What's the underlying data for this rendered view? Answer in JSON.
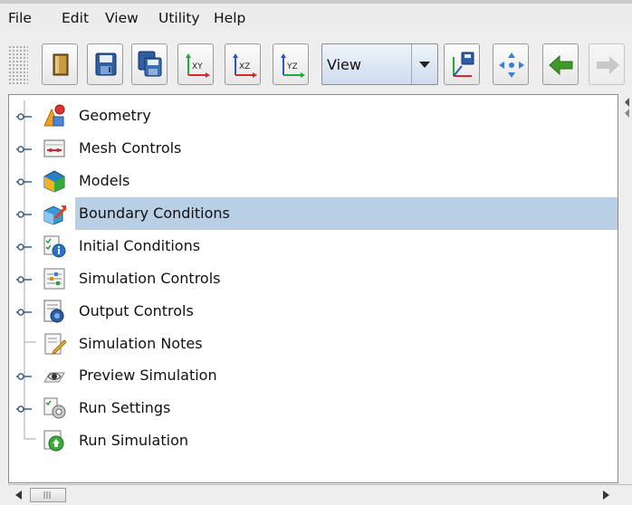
{
  "menubar": {
    "file": "File",
    "edit": "Edit",
    "view": "View",
    "utility": "Utility",
    "help": "Help"
  },
  "toolbar": {
    "buttons": [
      "open-icon",
      "save-icon",
      "save-all-icon",
      "axis-xy-icon",
      "axis-xz-icon",
      "axis-yz-icon",
      "export-view-icon",
      "pan-icon",
      "back-arrow-icon",
      "forward-arrow-icon"
    ],
    "axis_labels": {
      "xy": "XY",
      "xz": "XZ",
      "yz": "YZ"
    },
    "view_select": {
      "value": "View"
    }
  },
  "tree": {
    "selected_index": 3,
    "items": [
      {
        "label": "Geometry",
        "icon": "geometry-icon",
        "expandable": true
      },
      {
        "label": "Mesh Controls",
        "icon": "mesh-controls-icon",
        "expandable": true
      },
      {
        "label": "Models",
        "icon": "models-icon",
        "expandable": true
      },
      {
        "label": "Boundary Conditions",
        "icon": "boundary-conditions-icon",
        "expandable": true
      },
      {
        "label": "Initial Conditions",
        "icon": "initial-conditions-icon",
        "expandable": true
      },
      {
        "label": "Simulation Controls",
        "icon": "simulation-controls-icon",
        "expandable": true
      },
      {
        "label": "Output Controls",
        "icon": "output-controls-icon",
        "expandable": true
      },
      {
        "label": "Simulation Notes",
        "icon": "simulation-notes-icon",
        "expandable": false
      },
      {
        "label": "Preview Simulation",
        "icon": "preview-simulation-icon",
        "expandable": true
      },
      {
        "label": "Run Settings",
        "icon": "run-settings-icon",
        "expandable": true
      },
      {
        "label": "Run Simulation",
        "icon": "run-simulation-icon",
        "expandable": false
      }
    ]
  },
  "colors": {
    "selection": "#b8cfe5",
    "tree_line": "#a7a7a7",
    "handle": "#3a5e8c"
  }
}
